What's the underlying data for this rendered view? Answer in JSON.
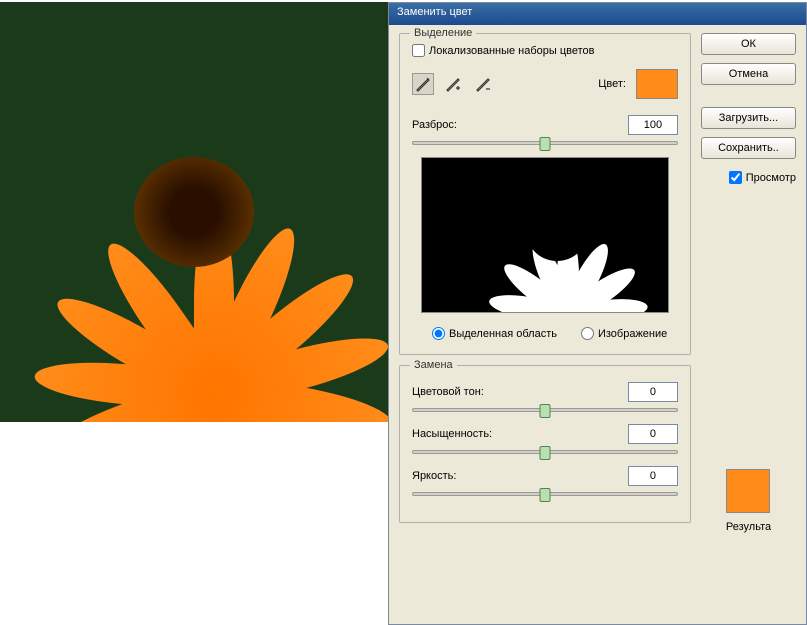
{
  "dialog": {
    "title": "Заменить цвет"
  },
  "selection": {
    "legend": "Выделение",
    "localized_sets_label": "Локализованные наборы цветов",
    "localized_sets_checked": false,
    "color_label": "Цвет:",
    "color_swatch": "#ff8c1a",
    "fuzziness_label": "Разброс:",
    "fuzziness_value": "100",
    "radio_selection": "Выделенная область",
    "radio_image": "Изображение"
  },
  "replacement": {
    "legend": "Замена",
    "hue_label": "Цветовой тон:",
    "hue_value": "0",
    "saturation_label": "Насыщенность:",
    "saturation_value": "0",
    "lightness_label": "Яркость:",
    "lightness_value": "0",
    "result_label": "Результа",
    "result_swatch": "#ff8c1a"
  },
  "buttons": {
    "ok": "ОК",
    "cancel": "Отмена",
    "load": "Загрузить...",
    "save": "Сохранить..",
    "preview_label": "Просмотр",
    "preview_checked": true
  }
}
